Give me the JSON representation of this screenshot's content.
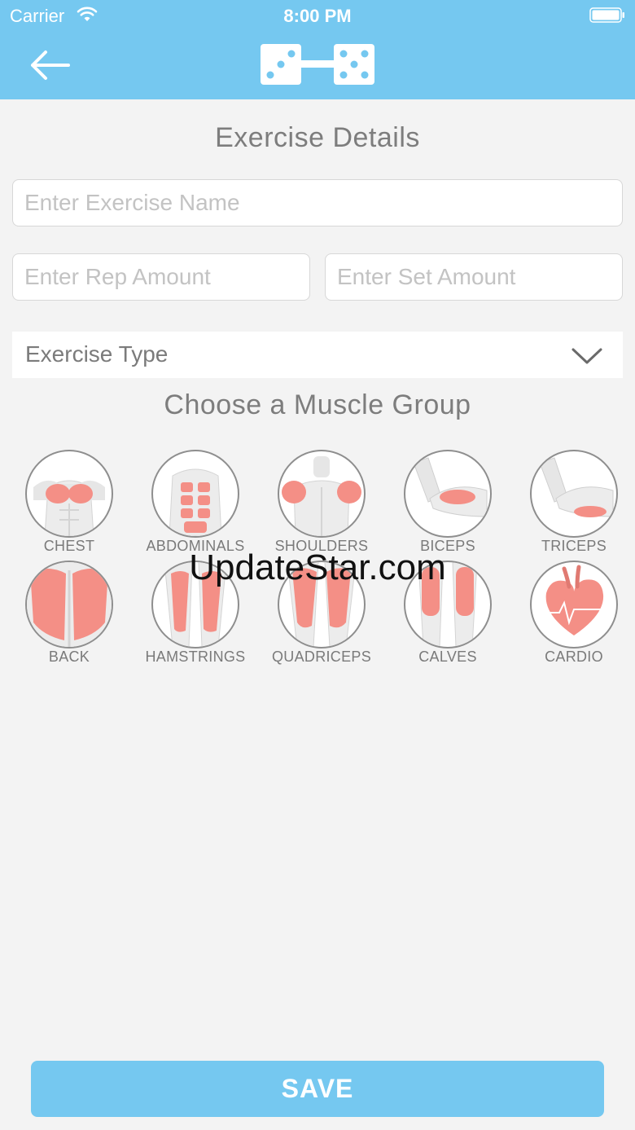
{
  "status_bar": {
    "carrier": "Carrier",
    "time": "8:00 PM"
  },
  "nav": {
    "back_icon": "arrow-left-icon",
    "logo_icon": "dumbbell-dice-icon"
  },
  "titles": {
    "details": "Exercise Details",
    "muscle": "Choose a Muscle Group"
  },
  "form": {
    "exercise_name": {
      "placeholder": "Enter Exercise Name",
      "value": ""
    },
    "rep_amount": {
      "placeholder": "Enter Rep Amount",
      "value": ""
    },
    "set_amount": {
      "placeholder": "Enter Set Amount",
      "value": ""
    },
    "exercise_type": {
      "label": "Exercise Type",
      "icon": "chevron-down-icon"
    }
  },
  "muscle_groups": [
    {
      "label": "CHEST",
      "icon": "chest-icon"
    },
    {
      "label": "ABDOMINALS",
      "icon": "abdominals-icon"
    },
    {
      "label": "SHOULDERS",
      "icon": "shoulders-icon"
    },
    {
      "label": "BICEPS",
      "icon": "biceps-icon"
    },
    {
      "label": "TRICEPS",
      "icon": "triceps-icon"
    },
    {
      "label": "BACK",
      "icon": "back-icon"
    },
    {
      "label": "HAMSTRINGS",
      "icon": "hamstrings-icon"
    },
    {
      "label": "QUADRICEPS",
      "icon": "quadriceps-icon"
    },
    {
      "label": "CALVES",
      "icon": "calves-icon"
    },
    {
      "label": "CARDIO",
      "icon": "heart-icon"
    }
  ],
  "watermark": "UpdateStar.com",
  "save_label": "SAVE",
  "colors": {
    "accent": "#75c8f0",
    "muscle_highlight": "#f48f86",
    "background": "#f3f3f3"
  }
}
